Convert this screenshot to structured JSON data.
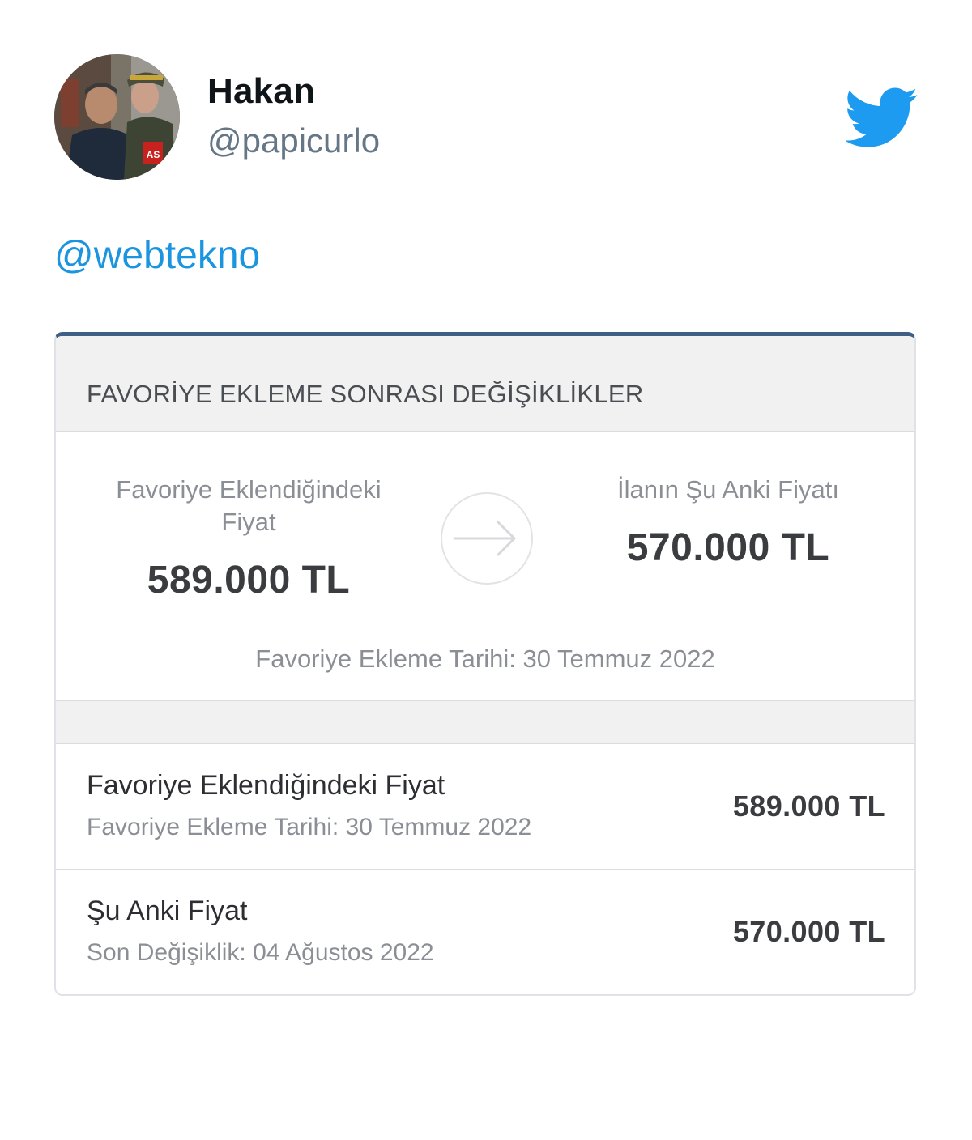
{
  "tweet": {
    "author": {
      "display_name": "Hakan",
      "handle": "@papicurlo",
      "avatar_badge_text": "AS"
    },
    "body_mention": "@webtekno",
    "brand_icon": "twitter-bird-icon",
    "colors": {
      "twitter_blue": "#1d9bf0",
      "mention_blue": "#1b95e0",
      "handle_gray": "#657786"
    }
  },
  "card": {
    "header_title": "FAVORİYE EKLEME SONRASI DEĞİŞİKLİKLER",
    "accent_color": "#3f5f85",
    "compare": {
      "left_label": "Favoriye Eklendiğindeki Fiyat",
      "left_price": "589.000 TL",
      "arrow_icon": "arrow-right-icon",
      "right_label": "İlanın Şu Anki Fiyatı",
      "right_price": "570.000 TL",
      "date_text": "Favoriye Ekleme Tarihi: 30 Temmuz 2022"
    },
    "rows": [
      {
        "title": "Favoriye Eklendiğindeki Fiyat",
        "subtitle": "Favoriye Ekleme Tarihi: 30 Temmuz 2022",
        "value": "589.000 TL"
      },
      {
        "title": "Şu Anki Fiyat",
        "subtitle": "Son Değişiklik: 04 Ağustos 2022",
        "value": "570.000 TL"
      }
    ]
  }
}
